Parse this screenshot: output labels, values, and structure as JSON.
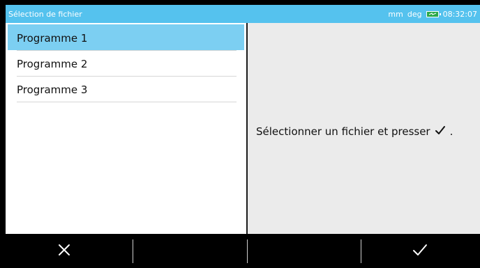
{
  "titlebar": {
    "title": "Sélection de fichier",
    "units_length": "mm",
    "units_angle": "deg",
    "time": "08:32:07",
    "battery_icon": "battery-charging-icon"
  },
  "file_list": {
    "items": [
      {
        "label": "Programme 1",
        "selected": true
      },
      {
        "label": "Programme 2",
        "selected": false
      },
      {
        "label": "Programme 3",
        "selected": false
      }
    ]
  },
  "preview": {
    "message": "Sélectionner un fichier et presser",
    "message_icon": "check-icon",
    "message_end": "."
  },
  "bottombar": {
    "cancel_icon": "close-icon",
    "confirm_icon": "check-icon"
  },
  "colors": {
    "titlebar": "#55c2ee",
    "selection": "#7ccff2",
    "battery": "#2aa84a"
  }
}
